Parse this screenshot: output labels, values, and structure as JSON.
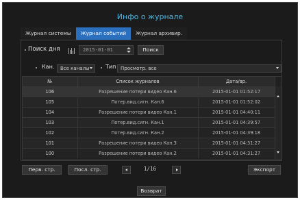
{
  "dialog": {
    "title": "Инфо о журнале"
  },
  "tabs": [
    {
      "label": "Журнал системы"
    },
    {
      "label": "Журнал событий"
    },
    {
      "label": "Журнал архивир."
    }
  ],
  "search": {
    "day_label": "Поиск дня",
    "date_value": "2015-01-01",
    "search_button": "Поиск"
  },
  "filters": {
    "channel_label": "Кан.",
    "channel_value": "Все каналы",
    "type_label": "Тип",
    "type_value": "Просмотр. все"
  },
  "table": {
    "headers": [
      "№",
      "Список журналов",
      "Дата/вр."
    ],
    "rows": [
      {
        "no": "106",
        "log": "Разрешение потери видео Кан.6",
        "datetime": "2015-01-01 01:52:17"
      },
      {
        "no": "105",
        "log": "Потер.вид.сигн. Кан.6",
        "datetime": "2015-01-01 01:52:02"
      },
      {
        "no": "104",
        "log": "Разрешение потери видео Кан.1",
        "datetime": "2015-01-01 04:40:11"
      },
      {
        "no": "103",
        "log": "Потер.вид.сигн. Кан.1",
        "datetime": "2015-01-01 04:39:57"
      },
      {
        "no": "102",
        "log": "Потер.вид.сигн. Кан.2",
        "datetime": "2015-01-01 04:39:18"
      },
      {
        "no": "101",
        "log": "Разрешение потери видео Кан.3",
        "datetime": "2015-01-01 04:31:27"
      },
      {
        "no": "100",
        "log": "Разрешение потери видео Кан.2",
        "datetime": "2015-01-01 04:31:27"
      }
    ]
  },
  "pager": {
    "first_label": "Перв. стр.",
    "last_label": "Посл. стр.",
    "page_info": "1/16",
    "export_label": "Экспорт"
  },
  "footer": {
    "back_label": "Возврат"
  },
  "colors": {
    "accent": "#2b6fbf",
    "title": "#4fb6e3",
    "background": "#1b1b1b"
  },
  "icons": [
    "calendar-icon",
    "chevron-up-icon",
    "chevron-down-icon",
    "arrow-left-icon",
    "arrow-right-icon"
  ]
}
